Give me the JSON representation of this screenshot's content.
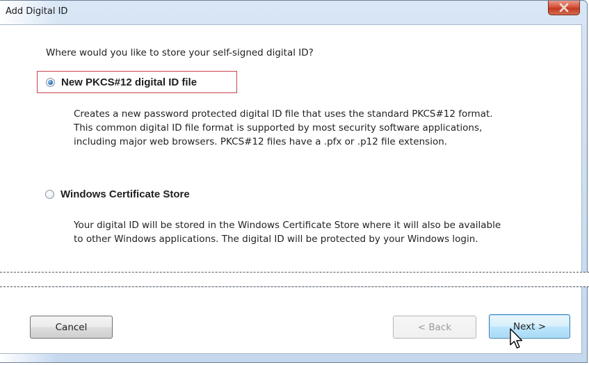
{
  "window": {
    "title": "Add Digital ID"
  },
  "content": {
    "question": "Where would you like to store your self-signed digital ID?",
    "options": [
      {
        "label": "New PKCS#12 digital ID file",
        "selected": true,
        "description": [
          "Creates a new password protected digital ID file that uses the standard PKCS#12 format.",
          "This common digital ID file format is supported by most security software applications,",
          "including major web browsers. PKCS#12 files have a .pfx or .p12 file extension."
        ]
      },
      {
        "label": "Windows Certificate Store",
        "selected": false,
        "description": [
          "Your digital ID will be stored in the Windows Certificate Store where it will also be available",
          "to other Windows applications. The digital ID will be protected by your Windows login."
        ]
      }
    ]
  },
  "buttons": {
    "cancel": "Cancel",
    "back": "< Back",
    "next": "Next >"
  },
  "colors": {
    "highlight_border": "#c9414b",
    "close_button": "#c33a20",
    "default_button": "#3c7fb1"
  }
}
